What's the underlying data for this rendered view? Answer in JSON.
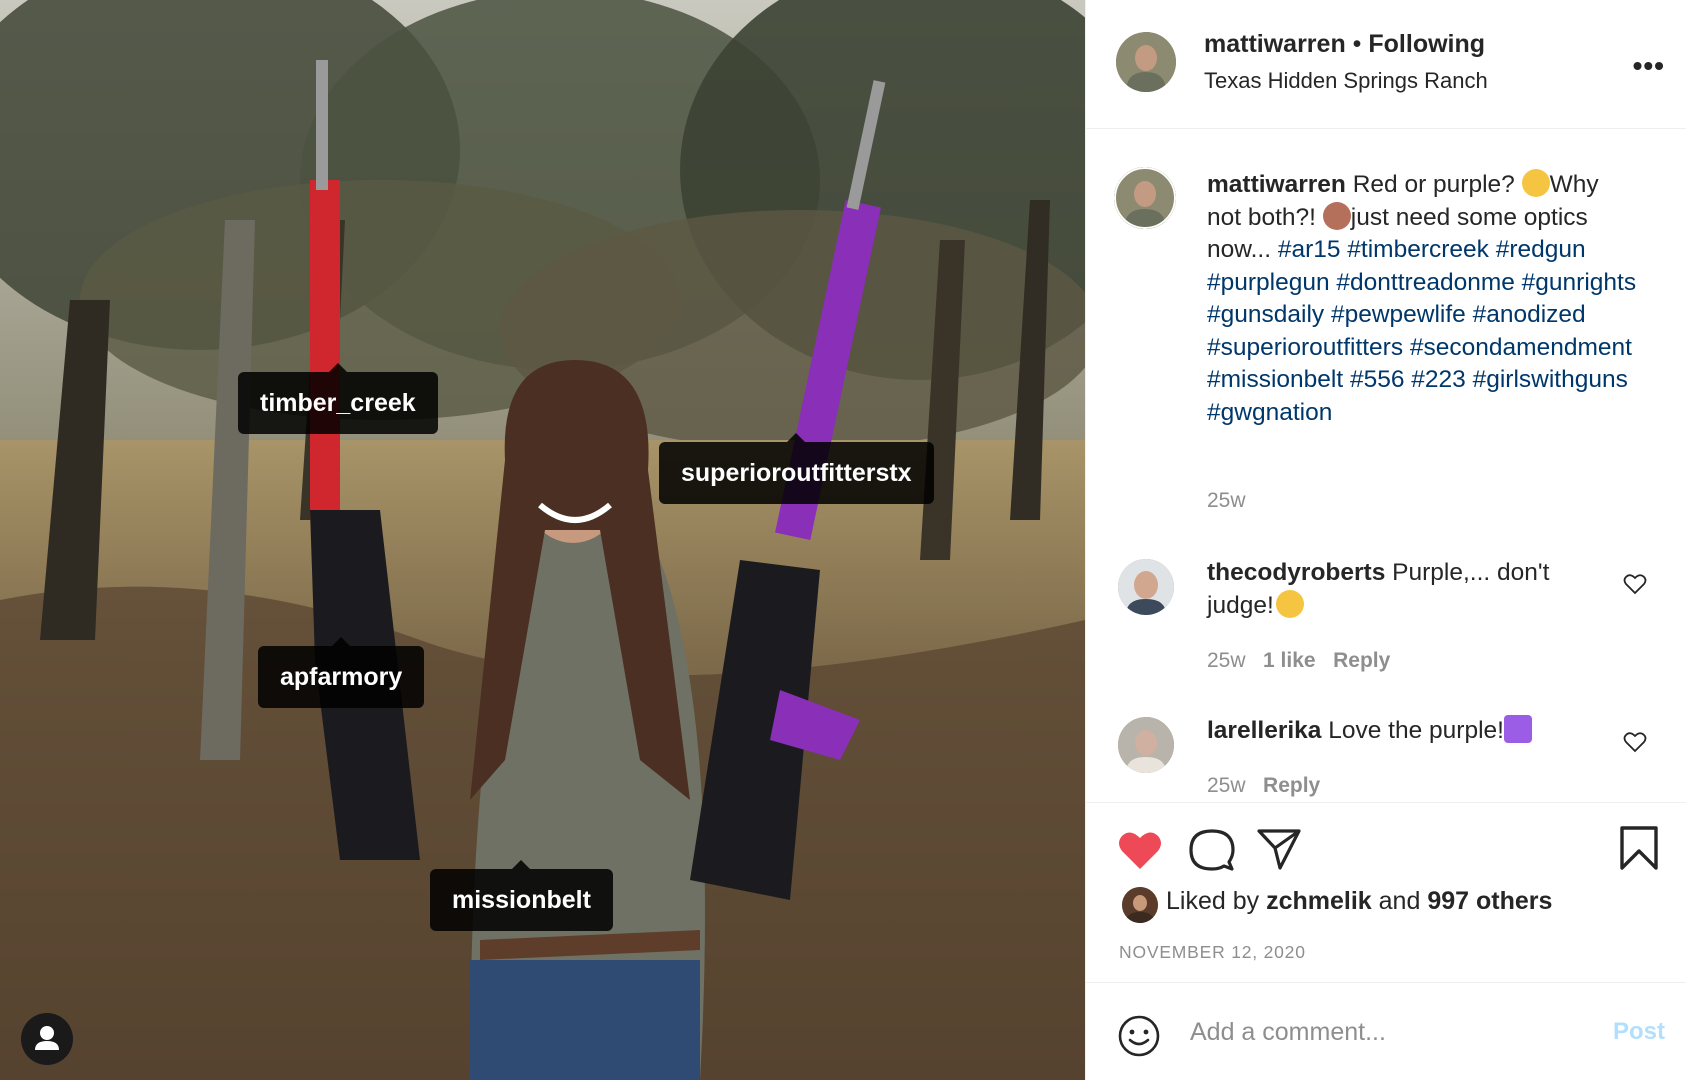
{
  "post": {
    "tags": [
      "timber_creek",
      "superioroutfitterstx",
      "apfarmory",
      "missionbelt"
    ]
  },
  "header": {
    "username": "mattiwarren",
    "separator": "•",
    "follow_status": "Following",
    "location": "Texas Hidden Springs Ranch",
    "more_label": "•••"
  },
  "caption": {
    "username": "mattiwarren",
    "text_1": "Red or purple? ",
    "text_2": "Why not both?! ",
    "text_3": "just need some optics now... ",
    "hashtags": "#ar15 #timbercreek #redgun #purplegun #donttreadonme #gunrights #gunsdaily #pewpewlife #anodized #superioroutfitters #secondamendment #missionbelt #556 #223 #girlswithguns #gwgnation",
    "time": "25w"
  },
  "comments": [
    {
      "username": "thecodyroberts",
      "text": "Purple,... don't judge!",
      "time": "25w",
      "likes": "1 like",
      "reply": "Reply"
    },
    {
      "username": "larellerika",
      "text": "Love the purple!",
      "time": "25w",
      "reply": "Reply"
    }
  ],
  "likes": {
    "prefix": "Liked by",
    "user": "zchmelik",
    "middle": "and",
    "others": "997 others"
  },
  "date": "NOVEMBER 12, 2020",
  "add_comment": {
    "placeholder": "Add a comment...",
    "post_label": "Post"
  },
  "colors": {
    "liked_heart": "#ed4956",
    "hashtag": "#00376b",
    "post_button": "#b2dffc"
  },
  "icons": [
    "heart-icon",
    "comment-icon",
    "share-icon",
    "bookmark-icon",
    "emoji-icon",
    "user-tag-icon",
    "more-icon"
  ]
}
